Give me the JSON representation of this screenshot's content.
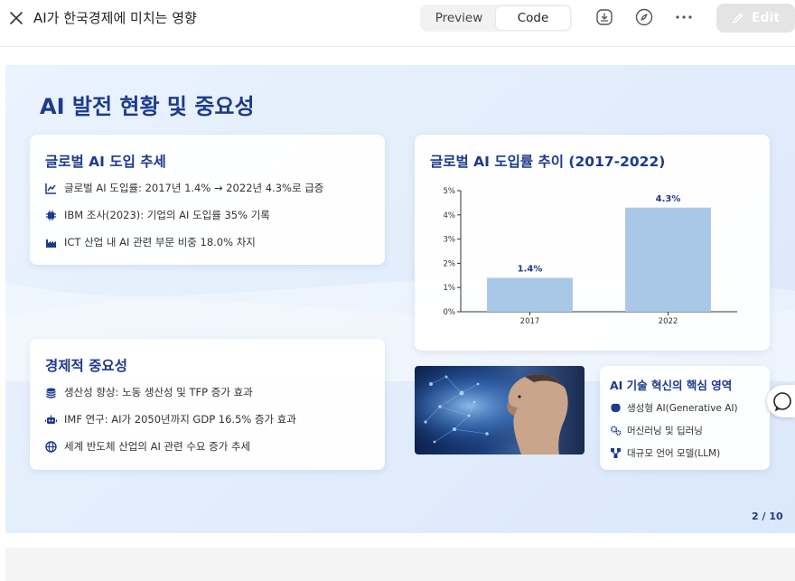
{
  "header": {
    "title": "AI가 한국경제에 미치는 영향",
    "tabs": [
      {
        "label": "Preview",
        "active": false
      },
      {
        "label": "Code",
        "active": true
      }
    ],
    "edit_label": "Edit"
  },
  "slide": {
    "title": "AI 발전 현황 및 중요성",
    "page": "2 / 10",
    "adoption_card": {
      "title": "글로벌 AI 도입 추세",
      "items": [
        {
          "icon": "chart-line-icon",
          "text": "글로벌 AI 도입률: 2017년 1.4% → 2022년 4.3%로 급증"
        },
        {
          "icon": "chip-icon",
          "text": "IBM 조사(2023): 기업의 AI 도입률 35% 기록"
        },
        {
          "icon": "industry-icon",
          "text": "ICT 산업 내 AI 관련 부문 비중 18.0% 차지"
        }
      ]
    },
    "economic_card": {
      "title": "경제적 중요성",
      "items": [
        {
          "icon": "coins-icon",
          "text": "생산성 향상: 노동 생산성 및 TFP 증가 효과"
        },
        {
          "icon": "robot-icon",
          "text": "IMF 연구: AI가 2050년까지 GDP 16.5% 증가 효과"
        },
        {
          "icon": "globe-icon",
          "text": "세계 반도체 산업의 AI 관련 수요 증가 추세"
        }
      ]
    },
    "chart_card": {
      "title": "글로벌 AI 도입률 추이 (2017-2022)"
    },
    "tech_card": {
      "title": "AI 기술 혁신의 핵심 영역",
      "items": [
        {
          "icon": "brain-icon",
          "text": "생성형 AI(Generative AI)"
        },
        {
          "icon": "gears-icon",
          "text": "머신러닝 및 딥러닝"
        },
        {
          "icon": "network-icon",
          "text": "대규모 언어 모델(LLM)"
        }
      ]
    }
  },
  "chart_data": {
    "type": "bar",
    "title": "",
    "categories": [
      "2017",
      "2022"
    ],
    "values": [
      1.4,
      4.3
    ],
    "value_labels": [
      "1.4%",
      "4.3%"
    ],
    "y_ticks": [
      "0%",
      "1%",
      "2%",
      "3%",
      "4%",
      "5%"
    ],
    "ylim": [
      0,
      5
    ],
    "xlabel": "",
    "ylabel": "",
    "grid": false,
    "bar_color": "#a9c8e8"
  },
  "colors": {
    "accent": "#1d3a8c",
    "bar": "#a9c8e8",
    "edit_button": "#e4e4e4"
  }
}
